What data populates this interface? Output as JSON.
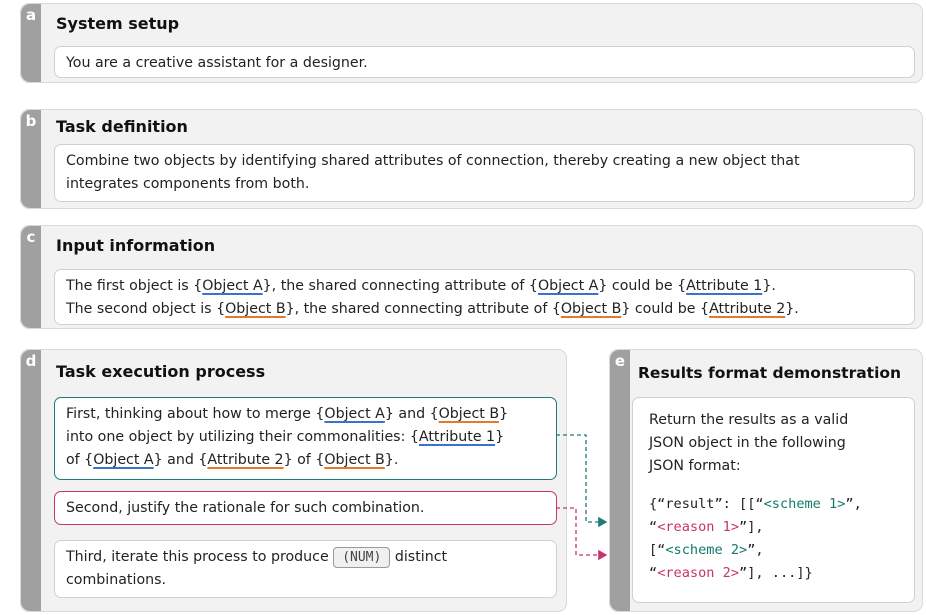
{
  "a": {
    "letter": "a",
    "title": "System setup",
    "text": "You are a creative assistant for a designer."
  },
  "b": {
    "letter": "b",
    "title": "Task definition",
    "line1": "Combine two objects by identifying shared attributes of connection, thereby creating a new object that",
    "line2": "integrates components from both."
  },
  "c": {
    "letter": "c",
    "title": "Input information",
    "l1_p1": "The first object is {",
    "l1_objA": "Object A",
    "l1_p2": "}, the shared connecting attribute of {",
    "l1_objA2": "Object A",
    "l1_p3": "} could be {",
    "l1_attr": "Attribute 1",
    "l1_p4": "}.",
    "l2_p1": "The second object is {",
    "l2_objB": "Object B",
    "l2_p2": "}, the shared connecting attribute of {",
    "l2_objB2": "Object B",
    "l2_p3": "} could be {",
    "l2_attr": "Attribute 2",
    "l2_p4": "}."
  },
  "d": {
    "letter": "d",
    "title": "Task execution process",
    "first": {
      "l1_p1": "First, thinking about how to merge {",
      "l1_objA": "Object A",
      "l1_p2": "} and {",
      "l1_objB": "Object B",
      "l1_p3": "}",
      "l2_p1": "into one object by utilizing their commonalities: {",
      "l2_attr1": "Attribute 1",
      "l2_p2": "}",
      "l3_p1": "of {",
      "l3_objA": "Object A",
      "l3_p2": "} and {",
      "l3_attr2": "Attribute 2",
      "l3_p3": "} of {",
      "l3_objB": "Object B",
      "l3_p4": "}."
    },
    "second": "Second, justify the rationale for such combination.",
    "third": {
      "p1": "Third, iterate this process to produce",
      "num": "(NUM)",
      "p2": "distinct",
      "line2": "combinations."
    }
  },
  "e": {
    "letter": "e",
    "title": "Results format demonstration",
    "text_l1": "Return the results as a valid",
    "text_l2": "JSON object in the following",
    "text_l3": "JSON format:",
    "code": {
      "l1_a": "{“result”: [[“",
      "l1_s": "<scheme 1>",
      "l1_b": "”,",
      "l2_a": "“",
      "l2_s": "<reason 1>",
      "l2_b": "”],",
      "l3_a": "[“",
      "l3_s": "<scheme 2>",
      "l3_b": "”,",
      "l4_a": "“",
      "l4_s": "<reason 2>",
      "l4_b": "”], ...]}"
    }
  },
  "colors": {
    "object_a_underline": "#3a73c8",
    "object_b_underline": "#e07a2e",
    "first_box_border": "#1f7a7a",
    "second_box_border": "#c8336f",
    "tag_background": "#a0a0a0",
    "panel_background": "#f2f2f2"
  }
}
